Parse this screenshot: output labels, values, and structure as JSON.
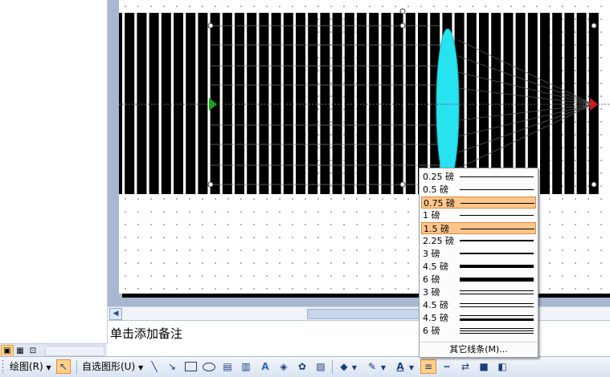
{
  "notes": {
    "placeholder_text": "单击添加备注"
  },
  "outline": {
    "views": [
      "normal-view-icon",
      "sorter-view-icon",
      "slideshow-view-icon"
    ]
  },
  "slide": {
    "bar_count": 40,
    "colors": {
      "bar": "#000000",
      "lens": "#27e3ef",
      "arrow_left": "#14a814",
      "arrow_right": "#d11a1a",
      "guide": "#ffffff"
    }
  },
  "line_menu": {
    "items": [
      {
        "label": "0.25 磅",
        "weight": 0.25,
        "style": "single",
        "highlighted": false
      },
      {
        "label": "0.5 磅",
        "weight": 0.5,
        "style": "single",
        "highlighted": false
      },
      {
        "label": "0.75 磅",
        "weight": 0.75,
        "style": "single",
        "highlighted": true
      },
      {
        "label": "1 磅",
        "weight": 1,
        "style": "single",
        "highlighted": false
      },
      {
        "label": "1.5 磅",
        "weight": 1.5,
        "style": "single",
        "highlighted": true
      },
      {
        "label": "2.25 磅",
        "weight": 2.25,
        "style": "single",
        "highlighted": false
      },
      {
        "label": "3 磅",
        "weight": 3,
        "style": "single",
        "highlighted": false
      },
      {
        "label": "4.5 磅",
        "weight": 4.5,
        "style": "single",
        "highlighted": false
      },
      {
        "label": "6 磅",
        "weight": 6,
        "style": "single",
        "highlighted": false
      },
      {
        "label": "3 磅",
        "weight": 3,
        "style": "double",
        "highlighted": false
      },
      {
        "label": "4.5 磅",
        "weight": 4.5,
        "style": "double",
        "highlighted": false
      },
      {
        "label": "4.5 磅",
        "weight": 4.5,
        "style": "double-thick",
        "highlighted": false
      },
      {
        "label": "6 磅",
        "weight": 6,
        "style": "triple",
        "highlighted": false
      }
    ],
    "more_label": "其它线条(M)..."
  },
  "toolbar": {
    "draw_label": "绘图(R)",
    "autoshapes_label": "自选图形(U)",
    "icons": [
      "select-pointer-icon",
      "line-icon",
      "arrow-icon",
      "rectangle-icon",
      "oval-icon",
      "textbox-icon",
      "vertical-textbox-icon",
      "wordart-icon",
      "diagram-icon",
      "clipart-icon",
      "picture-icon",
      "fill-color-icon",
      "line-color-icon",
      "font-color-icon",
      "line-style-icon",
      "dash-style-icon",
      "arrow-style-icon",
      "shadow-icon",
      "3d-icon"
    ]
  }
}
